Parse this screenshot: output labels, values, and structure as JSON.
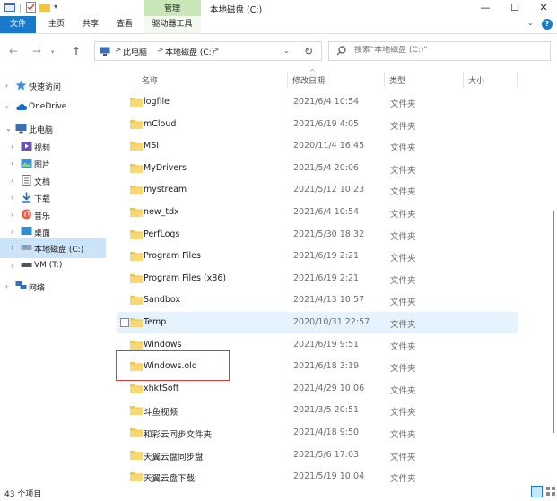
{
  "titlebar": {
    "manage_tab": "管理",
    "window_title": "本地磁盘 (C:)",
    "quick_access_dropdown": "▾",
    "minimize": "—",
    "maximize": "☐",
    "close": "✕"
  },
  "ribbon": {
    "tabs": [
      "文件",
      "主页",
      "共享",
      "查看",
      "驱动器工具"
    ],
    "collapse": "⌄",
    "help": "?"
  },
  "address": {
    "crumbs": [
      "此电脑",
      "本地磁盘 (C:)"
    ],
    "separator": ">",
    "dropdown": "⌄",
    "refresh": "↻"
  },
  "search": {
    "placeholder": "搜索\"本地磁盘 (C:)\""
  },
  "nav": {
    "items": [
      {
        "label": "快速访问",
        "icon": "star-icon"
      },
      {
        "label": "OneDrive",
        "icon": "cloud-icon"
      },
      {
        "label": "此电脑",
        "icon": "computer-icon"
      },
      {
        "label": "视频",
        "icon": "video-icon"
      },
      {
        "label": "图片",
        "icon": "pictures-icon"
      },
      {
        "label": "文档",
        "icon": "documents-icon"
      },
      {
        "label": "下载",
        "icon": "download-icon"
      },
      {
        "label": "音乐",
        "icon": "music-icon"
      },
      {
        "label": "桌面",
        "icon": "desktop-icon"
      },
      {
        "label": "本地磁盘 (C:)",
        "icon": "drive-icon"
      },
      {
        "label": "VM (T:)",
        "icon": "network-drive-icon"
      },
      {
        "label": "网络",
        "icon": "network-icon"
      }
    ]
  },
  "columns": {
    "name": "名称",
    "date": "修改日期",
    "type": "类型",
    "size": "大小"
  },
  "files": [
    {
      "name": "logfile",
      "date": "2021/6/4 10:54",
      "type": "文件夹"
    },
    {
      "name": "mCloud",
      "date": "2021/6/19 4:05",
      "type": "文件夹"
    },
    {
      "name": "MSI",
      "date": "2020/11/4 16:45",
      "type": "文件夹"
    },
    {
      "name": "MyDrivers",
      "date": "2021/5/4 20:06",
      "type": "文件夹"
    },
    {
      "name": "mystream",
      "date": "2021/5/12 10:23",
      "type": "文件夹"
    },
    {
      "name": "new_tdx",
      "date": "2021/6/4 10:54",
      "type": "文件夹"
    },
    {
      "name": "PerfLogs",
      "date": "2021/5/30 18:32",
      "type": "文件夹"
    },
    {
      "name": "Program Files",
      "date": "2021/6/19 2:21",
      "type": "文件夹"
    },
    {
      "name": "Program Files (x86)",
      "date": "2021/6/19 2:21",
      "type": "文件夹"
    },
    {
      "name": "Sandbox",
      "date": "2021/4/13 10:57",
      "type": "文件夹"
    },
    {
      "name": "Temp",
      "date": "2020/10/31 22:57",
      "type": "文件夹"
    },
    {
      "name": "Windows",
      "date": "2021/6/19 9:51",
      "type": "文件夹"
    },
    {
      "name": "Windows.old",
      "date": "2021/6/18 3:19",
      "type": "文件夹"
    },
    {
      "name": "xhktSoft",
      "date": "2021/4/29 10:06",
      "type": "文件夹"
    },
    {
      "name": "斗鱼视频",
      "date": "2021/3/5 20:51",
      "type": "文件夹"
    },
    {
      "name": "和彩云同步文件夹",
      "date": "2021/4/18 9:50",
      "type": "文件夹"
    },
    {
      "name": "天翼云盘同步盘",
      "date": "2021/5/6 17:03",
      "type": "文件夹"
    },
    {
      "name": "天翼云盘下载",
      "date": "2021/5/19 10:04",
      "type": "文件夹"
    }
  ],
  "status": {
    "item_count": "43 个项目"
  },
  "colors": {
    "accent": "#1979ca",
    "manage_tab": "#c8e6b8",
    "selection": "#cce4f7",
    "hover_row": "#e5f3ff",
    "folder": "#f3c342",
    "highlight_box": "#d63b3b"
  }
}
